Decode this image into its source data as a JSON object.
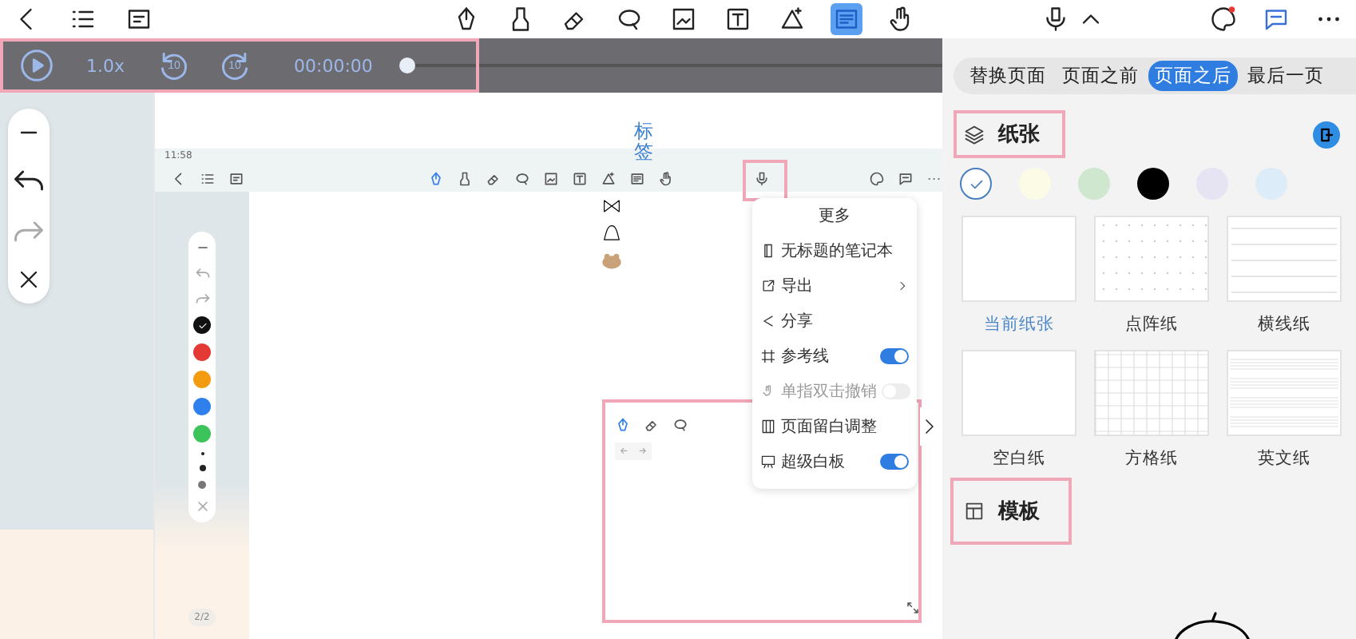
{
  "top_toolbar": {
    "tools": [
      {
        "selected": false
      },
      {
        "selected": false
      },
      {
        "selected": false
      },
      {
        "selected": false
      },
      {
        "selected": false
      },
      {
        "selected": false
      },
      {
        "selected": false
      },
      {
        "selected": true
      },
      {
        "selected": false
      }
    ]
  },
  "player": {
    "speed": "1.0x",
    "skip_back": "10",
    "skip_forward": "10",
    "time": "00:00:00",
    "level": 0
  },
  "tabs": [
    {
      "label": "替换页面",
      "selected": false
    },
    {
      "label": "页面之前",
      "selected": false
    },
    {
      "label": "页面之后",
      "selected": true
    },
    {
      "label": "最后一页",
      "selected": false
    }
  ],
  "paper": {
    "title": "纸张",
    "colors": [
      {
        "color": "#ffffff",
        "selected": true
      },
      {
        "color": "#fbfbe6",
        "selected": false
      },
      {
        "color": "#cfe6cf",
        "selected": false
      },
      {
        "color": "#000000",
        "selected": false
      },
      {
        "color": "#e6e4f3",
        "selected": false
      },
      {
        "color": "#dcecf8",
        "selected": false
      }
    ],
    "types": [
      {
        "label": "当前纸张",
        "kind": "blank",
        "selected": true
      },
      {
        "label": "点阵纸",
        "kind": "dots",
        "selected": false
      },
      {
        "label": "横线纸",
        "kind": "lines",
        "selected": false
      },
      {
        "label": "空白纸",
        "kind": "blank",
        "selected": false
      },
      {
        "label": "方格纸",
        "kind": "grid",
        "selected": false
      },
      {
        "label": "英文纸",
        "kind": "english",
        "selected": false
      }
    ]
  },
  "template": {
    "title": "模板"
  },
  "preview": {
    "tag_label": "标签",
    "time": "11:58",
    "page": "2/2",
    "pen_colors": [
      {
        "color": "#111111",
        "selected": true
      },
      {
        "color": "#e53935",
        "selected": false
      },
      {
        "color": "#f39c12",
        "selected": false
      },
      {
        "color": "#2f80ed",
        "selected": false
      },
      {
        "color": "#3cc35a",
        "selected": false
      }
    ],
    "menu": {
      "title": "更多",
      "items": [
        {
          "label": "无标题的笔记本",
          "kind": "plain"
        },
        {
          "label": "导出",
          "kind": "chevron"
        },
        {
          "label": "分享",
          "kind": "plain"
        },
        {
          "label": "参考线",
          "kind": "toggle",
          "on": true
        },
        {
          "label": "单指双击撤销",
          "kind": "toggle",
          "on": false
        },
        {
          "label": "页面留白调整",
          "kind": "plain"
        },
        {
          "label": "超级白板",
          "kind": "toggle",
          "on": true
        }
      ]
    }
  }
}
